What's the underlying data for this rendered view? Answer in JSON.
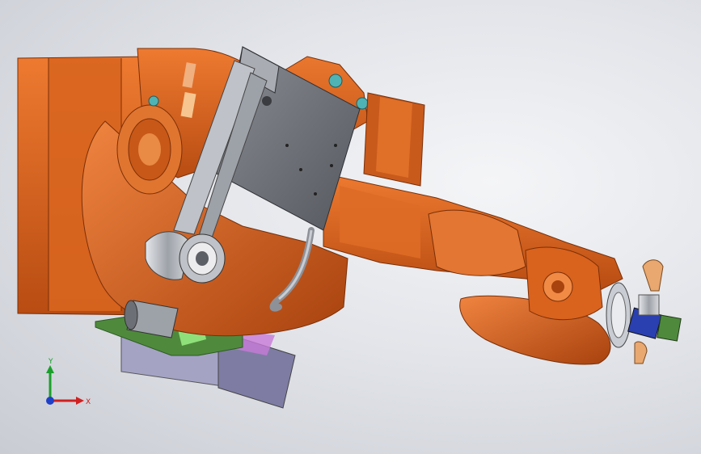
{
  "viewport": {
    "background_top": "#f4f5f7",
    "background_bottom": "#c9ccd3"
  },
  "model": {
    "robot_color": "#d9621d",
    "robot_shadow": "#a9430f",
    "bracket_color": "#6c6f76",
    "tool_color": "#b9bcc2",
    "fixture_green": "#4f8a3c",
    "base_block": "#9a98b8",
    "connector_teal": "#4fb3b5"
  },
  "triad": {
    "x_label": "X",
    "y_label": "Y",
    "x_color": "#d02020",
    "y_color": "#1aa02a",
    "z_color": "#2040c8"
  }
}
